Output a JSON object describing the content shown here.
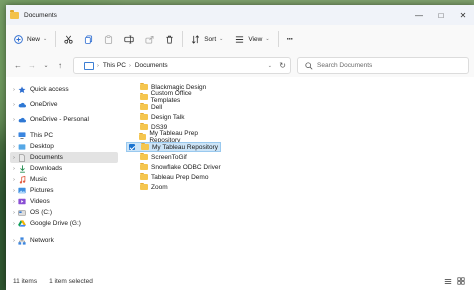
{
  "window": {
    "title": "Documents"
  },
  "titlebar": {
    "minimize": "—",
    "maximize": "□",
    "close": "✕"
  },
  "toolbar": {
    "new_label": "New",
    "sort_label": "Sort",
    "view_label": "View",
    "more_label": "···"
  },
  "address": {
    "crumbs": [
      "This PC",
      "Documents"
    ]
  },
  "search": {
    "placeholder": "Search Documents"
  },
  "nav": {
    "items": [
      {
        "label": "Quick access"
      },
      {
        "label": "OneDrive"
      },
      {
        "label": "OneDrive - Personal"
      },
      {
        "label": "This PC"
      },
      {
        "label": "Desktop"
      },
      {
        "label": "Documents"
      },
      {
        "label": "Downloads"
      },
      {
        "label": "Music"
      },
      {
        "label": "Pictures"
      },
      {
        "label": "Videos"
      },
      {
        "label": "OS (C:)"
      },
      {
        "label": "Google Drive (G:)"
      },
      {
        "label": "Network"
      }
    ]
  },
  "files": [
    {
      "name": "Blackmagic Design"
    },
    {
      "name": "Custom Office Templates"
    },
    {
      "name": "Dell"
    },
    {
      "name": "Design Talk"
    },
    {
      "name": "DS39"
    },
    {
      "name": "My Tableau Prep Repository"
    },
    {
      "name": "My Tableau Repository"
    },
    {
      "name": "ScreenToGif"
    },
    {
      "name": "Snowflake ODBC Driver"
    },
    {
      "name": "Tableau Prep Demo"
    },
    {
      "name": "Zoom"
    }
  ],
  "status": {
    "item_count": "11 items",
    "selected": "1 item selected"
  },
  "colors": {
    "accent": "#1a73d0",
    "selection": "#cce4f7",
    "folder": "#f5c64f"
  }
}
